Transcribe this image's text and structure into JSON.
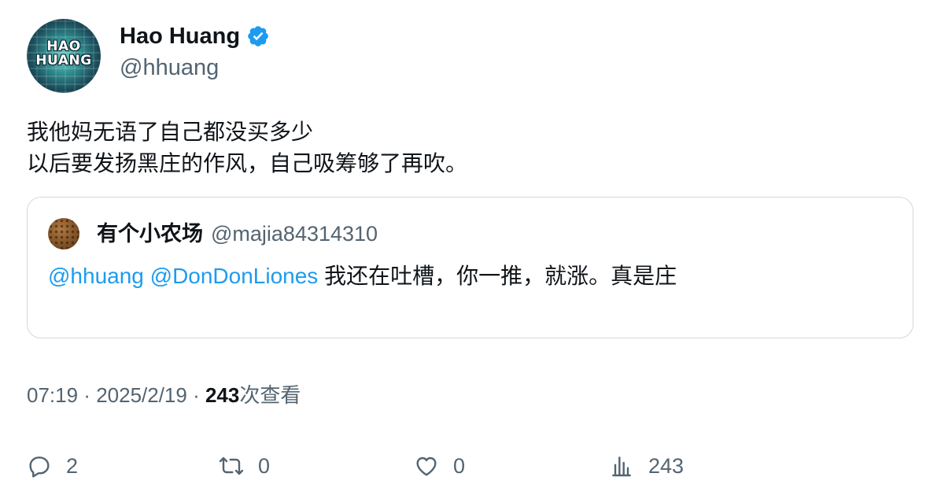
{
  "tweet": {
    "author_name": "Hao Huang",
    "author_handle": "@hhuang",
    "avatar_text_line1": "HAO",
    "avatar_text_line2": "HUANG",
    "text_line1": "我他妈无语了自己都没买多少",
    "text_line2": "以后要发扬黑庄的作风，自己吸筹够了再吹。",
    "verified_icon": "verified-badge-icon",
    "colors": {
      "accent": "#1d9bf0",
      "secondary_text": "#536471",
      "primary_text": "#0f1419"
    }
  },
  "quote": {
    "author_name": "有个小农场",
    "author_handle": "@majia84314310",
    "mention1": "@hhuang",
    "mention2": "@DonDonLiones",
    "text": "我还在吐槽，你一推，就涨。真是庄"
  },
  "meta": {
    "time": "07:19",
    "separator": " · ",
    "date": "2025/2/19",
    "views_count": "243",
    "views_label": "次查看"
  },
  "actions": {
    "reply_count": "2",
    "repost_count": "0",
    "like_count": "0",
    "views_count": "243"
  }
}
